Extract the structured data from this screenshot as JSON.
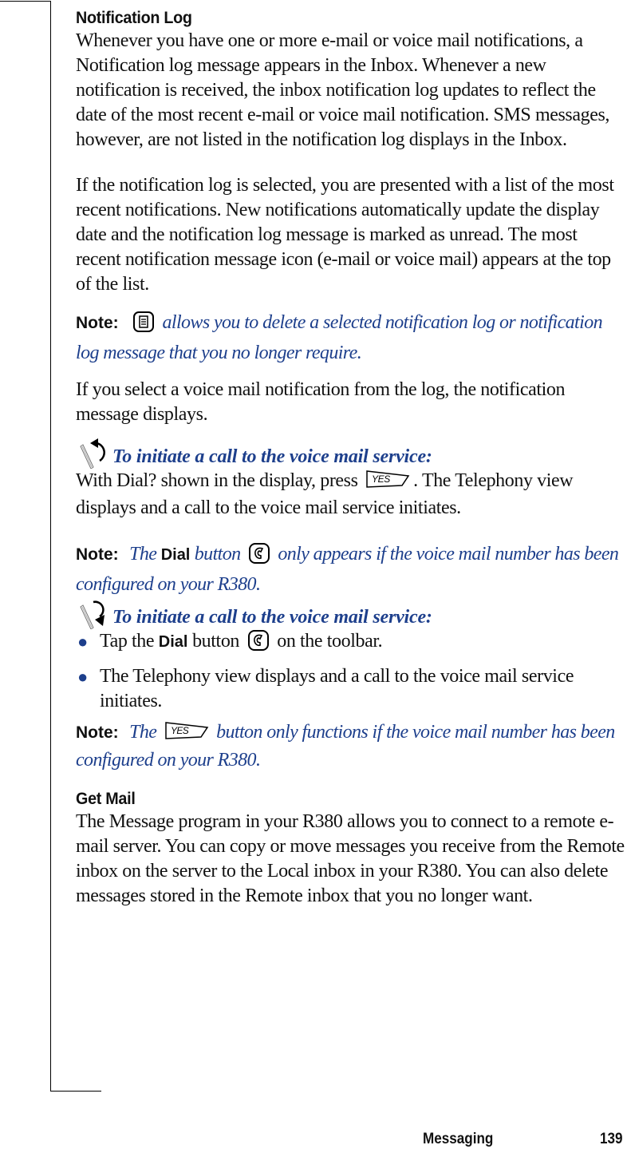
{
  "sections": {
    "notification_log": {
      "heading": "Notification Log",
      "para1": "Whenever you have one or more e-mail or voice mail notifications, a Notification log message appears in the Inbox. Whenever a new notification is received, the inbox notification log updates to reflect the date of the most recent e-mail or voice mail notification. SMS messages, however, are not listed in the notification log displays in the Inbox.",
      "para2": "If the notification log is selected, you are presented with a list of the most recent notifications. New notifications automatically update the display date and the notification log message is marked as unread. The most recent notification message icon (e-mail or voice mail) appears at the top of the list.",
      "note1": {
        "label": "Note:",
        "icon": "menu-icon",
        "text": "allows you to delete a selected notification log or notification log message that you no longer require."
      },
      "para3": "If you select a voice mail notification from the log, the notification message displays.",
      "procedure1": {
        "title": "To initiate a call to the voice mail service:",
        "text_before": "With Dial? shown in the display, press",
        "button": "YES",
        "text_after": ". The Telephony view displays and a call to the voice mail service initiates."
      },
      "note2": {
        "label": "Note:",
        "text_the": "The",
        "dial_word": "Dial",
        "text_button": "button",
        "icon": "phone-icon",
        "text_rest": "only appears if the voice mail number has been configured on your R380."
      },
      "procedure2": {
        "title": "To initiate a call to the voice mail service:",
        "bullets": [
          {
            "before": "Tap the",
            "bold": "Dial",
            "middle": "button",
            "icon": "phone-icon",
            "after": "on the toolbar."
          },
          {
            "text": "The Telephony view displays and a call to the voice mail service initiates."
          }
        ]
      },
      "note3": {
        "label": "Note:",
        "text_the": "The",
        "button": "YES",
        "text_rest": "button only functions if the voice mail number has been configured on your R380."
      }
    },
    "get_mail": {
      "heading": "Get Mail",
      "para": "The Message program in your R380 allows you to connect to a remote e-mail server. You can copy or move messages you receive from the Remote inbox on the server to the Local inbox in your R380. You can also delete messages stored in the Remote inbox that you no longer want."
    }
  },
  "footer": {
    "section": "Messaging",
    "page": "139"
  },
  "colors": {
    "note_blue": "#1d3f8c",
    "text": "#111111"
  }
}
